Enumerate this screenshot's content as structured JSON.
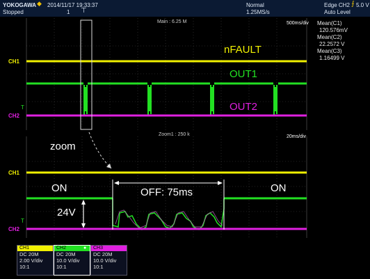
{
  "header": {
    "brand": "YOKOGAWA",
    "date_time": "2014/11/17 19:33:37",
    "status": "Stopped",
    "count": "1",
    "acq_mode": "Normal",
    "sample_rate": "1.25MS/s",
    "trigger": "Edge CH2",
    "trigger_level": "5.0 V",
    "trigger_mode": "Auto Level"
  },
  "main_window": {
    "label": "Main : 6.25 M",
    "timebase": "500ms/div"
  },
  "zoom_window": {
    "label": "Zoom1 : 250 k",
    "timebase": "20ms/div"
  },
  "measurements": [
    {
      "label": "Mean(C1)",
      "value": "120.576mV"
    },
    {
      "label": "Mean(C2)",
      "value": "22.2572 V"
    },
    {
      "label": "Mean(C3)",
      "value": "1.16499 V"
    }
  ],
  "channel_labels": {
    "ch1": "CH1",
    "ch2": "CH2"
  },
  "annotations": {
    "nfault": "nFAULT",
    "out1": "OUT1",
    "out2": "OUT2",
    "zoom": "zoom",
    "on_left": "ON",
    "on_right": "ON",
    "off": "OFF: 75ms",
    "voltage": "24V"
  },
  "channels": [
    {
      "name": "CH1",
      "coupling": "DC 20M",
      "scale": "2.00 V/div",
      "probe": "10:1",
      "color": "#f0f000"
    },
    {
      "name": "CH2",
      "coupling": "DC 20M",
      "scale": "10.0 V/div",
      "probe": "10:1",
      "color": "#22e022"
    },
    {
      "name": "CH3",
      "coupling": "DC 20M",
      "scale": "10.0 V/div",
      "probe": "10:1",
      "color": "#e020e0"
    }
  ],
  "colors": {
    "ch1": "#f0f000",
    "ch2": "#22e022",
    "ch3": "#e020e0",
    "header_bg": "#0b1a33"
  }
}
